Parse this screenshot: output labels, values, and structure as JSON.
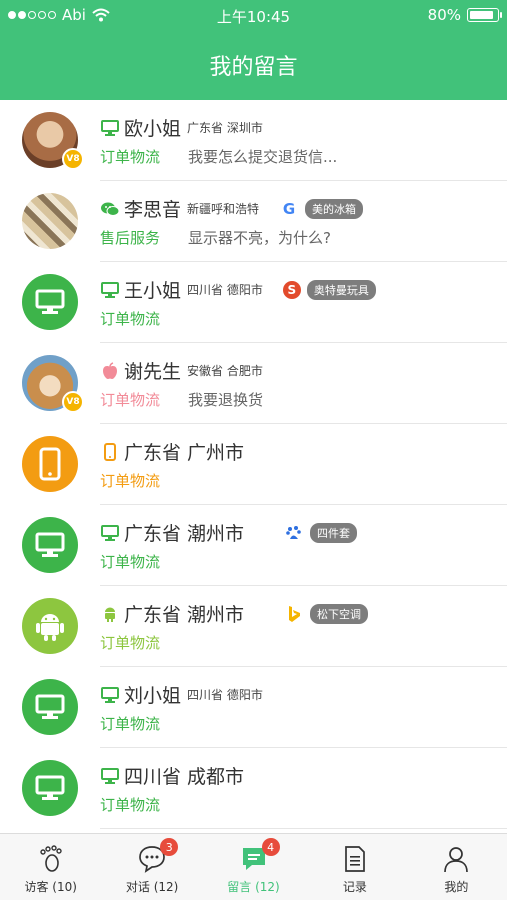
{
  "status_bar": {
    "carrier": "Abi",
    "time": "上午10:45",
    "battery": "80%"
  },
  "nav": {
    "title": "我的留言"
  },
  "rows": [
    {
      "name": "欧小姐",
      "location": "广东省  深圳市",
      "category": "订单物流",
      "message": "我要怎么提交退货信...",
      "vip": "V8"
    },
    {
      "name": "李思音",
      "location": "新疆呼和浩特",
      "engine": "G",
      "tag": "美的冰箱",
      "category": "售后服务",
      "message": "显示器不亮，为什么?"
    },
    {
      "name": "王小姐",
      "location": "四川省  德阳市",
      "engine": "S",
      "tag": "奥特曼玩具",
      "category": "订单物流"
    },
    {
      "name": "谢先生",
      "location": "安徽省  合肥市",
      "category": "订单物流",
      "message": "我要退换货",
      "vip": "V8"
    },
    {
      "name": "广东省  广州市",
      "category": "订单物流"
    },
    {
      "name": "广东省  潮州市",
      "tag": "四件套",
      "category": "订单物流"
    },
    {
      "name": "广东省  潮州市",
      "tag": "松下空调",
      "category": "订单物流"
    },
    {
      "name": "刘小姐",
      "location": "四川省  德阳市",
      "category": "订单物流"
    },
    {
      "name": "四川省  成都市",
      "category": "订单物流"
    }
  ],
  "tabs": [
    {
      "label": "访客 (10)"
    },
    {
      "label": "对话 (12)",
      "badge": "3"
    },
    {
      "label": "留言 (12)",
      "badge": "4"
    },
    {
      "label": "记录"
    },
    {
      "label": "我的"
    }
  ],
  "colors": {
    "brand": "#41c27a",
    "badge": "#e74c3c",
    "vip": "#f5b400",
    "tag": "#7d7d7d"
  }
}
